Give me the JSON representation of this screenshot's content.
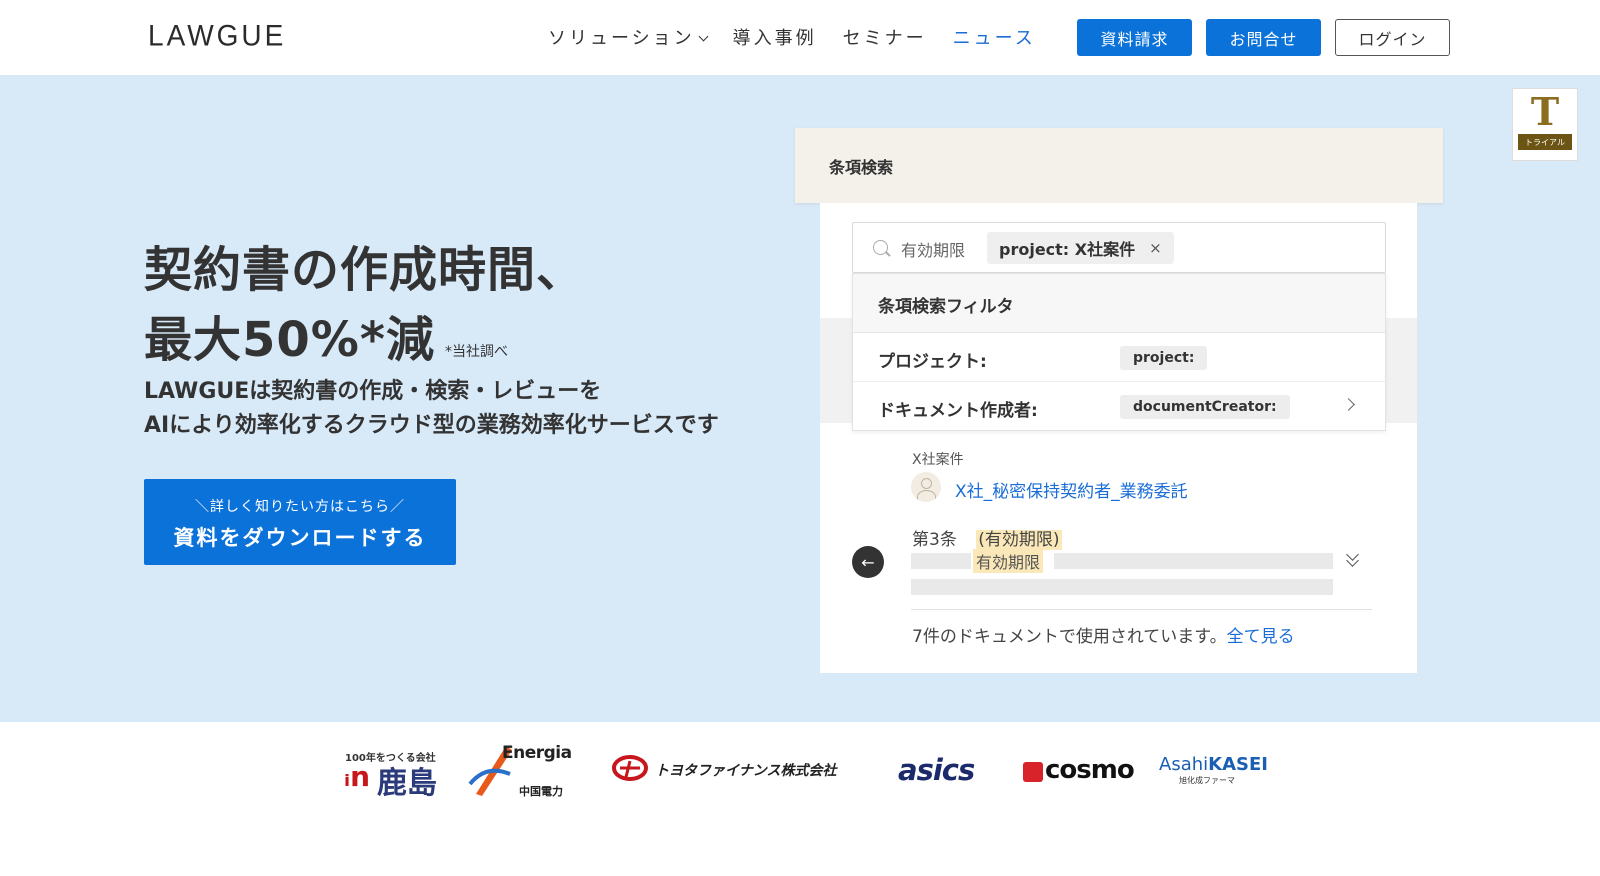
{
  "header": {
    "logo": "LAWGUE",
    "nav": [
      {
        "label": "ソリューション",
        "has_dropdown": true,
        "active": false
      },
      {
        "label": "導入事例",
        "has_dropdown": false,
        "active": false
      },
      {
        "label": "セミナー",
        "has_dropdown": false,
        "active": false
      },
      {
        "label": "ニュース",
        "has_dropdown": false,
        "active": true
      }
    ],
    "buttons": {
      "request_docs": "資料請求",
      "contact": "お問合せ",
      "login": "ログイン"
    }
  },
  "hero": {
    "title_line1": "契約書の作成時間、",
    "title_line2": "最大50%*減",
    "title_note": "*当社調べ",
    "subtitle_line1": "LAWGUEは契約書の作成・検索・レビューを",
    "subtitle_line2": "AIにより効率化するクラウド型の業務効率化サービスです",
    "cta_small": "＼詳しく知りたい方はこちら／",
    "cta_main": "資料をダウンロードする"
  },
  "badge": {
    "icon": "trial-logo-icon",
    "label": "トライアル"
  },
  "mockup": {
    "header_label": "条項検索",
    "search": {
      "query": "有効期限",
      "chip": "project: X社案件",
      "chip_remove": "×"
    },
    "filter": {
      "title": "条項検索フィルタ",
      "rows": [
        {
          "label": "プロジェクト:",
          "tag": "project:",
          "has_arrow": false
        },
        {
          "label": "ドキュメント作成者:",
          "tag": "documentCreator:",
          "has_arrow": true
        }
      ]
    },
    "result": {
      "project": "X社案件",
      "document_link": "X社_秘密保持契約者_業務委託",
      "article_number": "第3条",
      "article_title": "(有効期限)",
      "highlight": "有効期限",
      "usage_text": "7件のドキュメントで使用されています。",
      "usage_link": "全て見る"
    }
  },
  "clients": {
    "kajima_small": "100年をつくる会社",
    "kajima": "鹿島",
    "energia": "Energia",
    "energia_sub": "中国電力",
    "toyota": "トヨタファイナンス株式会社",
    "asics": "asics",
    "cosmo": "cosmo",
    "asahi_light": "Asahi",
    "asahi_bold": "KASEI",
    "asahi_sub": "旭化成ファーマ"
  },
  "colors": {
    "primary": "#0b72d9",
    "hero_bg": "#d8e9f8",
    "link": "#1a6dd6",
    "highlight": "#fbe8b8"
  }
}
